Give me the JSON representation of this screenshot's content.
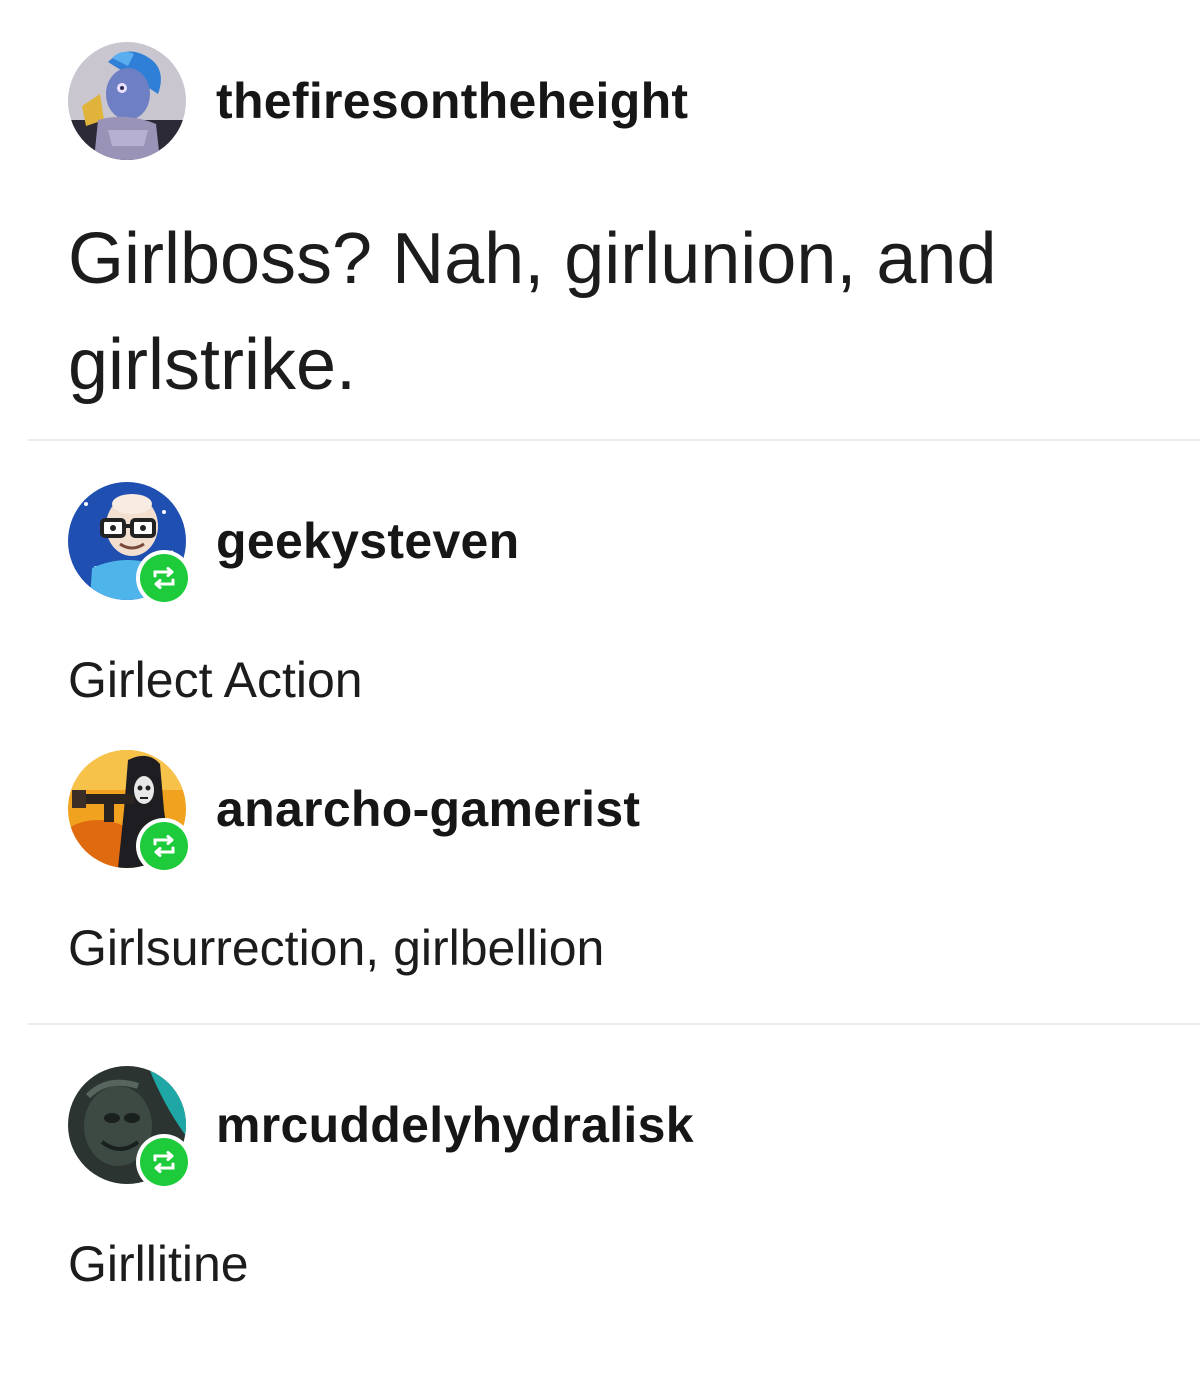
{
  "thread": [
    {
      "username": "thefiresontheheight",
      "text": "Girlboss? Nah, girlunion, and girlstrike.",
      "avatar": "blue-haired-character-avatar",
      "reblog": false
    },
    {
      "username": "geekysteven",
      "text": "Girlect Action",
      "avatar": "bald-glasses-cartoon-avatar",
      "reblog": true
    },
    {
      "username": "anarcho-gamerist",
      "text": "Girlsurrection, girlbellion",
      "avatar": "masked-gunner-avatar",
      "reblog": true
    },
    {
      "username": "mrcuddelyhydralisk",
      "text": "Girllitine",
      "avatar": "dark-creature-avatar",
      "reblog": true
    }
  ],
  "colors": {
    "reblog_badge": "#1ecb3a",
    "divider": "#ececec",
    "text": "#1c1c1c"
  }
}
